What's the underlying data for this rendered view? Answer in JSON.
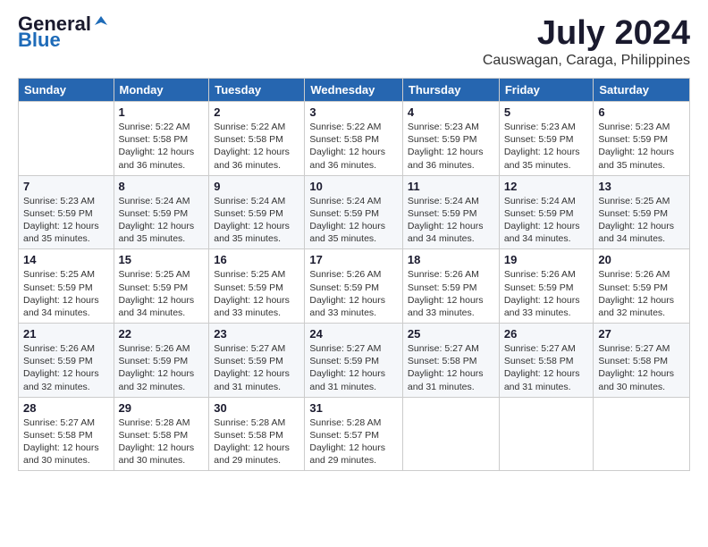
{
  "logo": {
    "general": "General",
    "blue": "Blue"
  },
  "title": {
    "month_year": "July 2024",
    "location": "Causwagan, Caraga, Philippines"
  },
  "headers": [
    "Sunday",
    "Monday",
    "Tuesday",
    "Wednesday",
    "Thursday",
    "Friday",
    "Saturday"
  ],
  "weeks": [
    [
      {
        "day": "",
        "info": ""
      },
      {
        "day": "1",
        "info": "Sunrise: 5:22 AM\nSunset: 5:58 PM\nDaylight: 12 hours\nand 36 minutes."
      },
      {
        "day": "2",
        "info": "Sunrise: 5:22 AM\nSunset: 5:58 PM\nDaylight: 12 hours\nand 36 minutes."
      },
      {
        "day": "3",
        "info": "Sunrise: 5:22 AM\nSunset: 5:58 PM\nDaylight: 12 hours\nand 36 minutes."
      },
      {
        "day": "4",
        "info": "Sunrise: 5:23 AM\nSunset: 5:59 PM\nDaylight: 12 hours\nand 36 minutes."
      },
      {
        "day": "5",
        "info": "Sunrise: 5:23 AM\nSunset: 5:59 PM\nDaylight: 12 hours\nand 35 minutes."
      },
      {
        "day": "6",
        "info": "Sunrise: 5:23 AM\nSunset: 5:59 PM\nDaylight: 12 hours\nand 35 minutes."
      }
    ],
    [
      {
        "day": "7",
        "info": "Sunrise: 5:23 AM\nSunset: 5:59 PM\nDaylight: 12 hours\nand 35 minutes."
      },
      {
        "day": "8",
        "info": "Sunrise: 5:24 AM\nSunset: 5:59 PM\nDaylight: 12 hours\nand 35 minutes."
      },
      {
        "day": "9",
        "info": "Sunrise: 5:24 AM\nSunset: 5:59 PM\nDaylight: 12 hours\nand 35 minutes."
      },
      {
        "day": "10",
        "info": "Sunrise: 5:24 AM\nSunset: 5:59 PM\nDaylight: 12 hours\nand 35 minutes."
      },
      {
        "day": "11",
        "info": "Sunrise: 5:24 AM\nSunset: 5:59 PM\nDaylight: 12 hours\nand 34 minutes."
      },
      {
        "day": "12",
        "info": "Sunrise: 5:24 AM\nSunset: 5:59 PM\nDaylight: 12 hours\nand 34 minutes."
      },
      {
        "day": "13",
        "info": "Sunrise: 5:25 AM\nSunset: 5:59 PM\nDaylight: 12 hours\nand 34 minutes."
      }
    ],
    [
      {
        "day": "14",
        "info": "Sunrise: 5:25 AM\nSunset: 5:59 PM\nDaylight: 12 hours\nand 34 minutes."
      },
      {
        "day": "15",
        "info": "Sunrise: 5:25 AM\nSunset: 5:59 PM\nDaylight: 12 hours\nand 34 minutes."
      },
      {
        "day": "16",
        "info": "Sunrise: 5:25 AM\nSunset: 5:59 PM\nDaylight: 12 hours\nand 33 minutes."
      },
      {
        "day": "17",
        "info": "Sunrise: 5:26 AM\nSunset: 5:59 PM\nDaylight: 12 hours\nand 33 minutes."
      },
      {
        "day": "18",
        "info": "Sunrise: 5:26 AM\nSunset: 5:59 PM\nDaylight: 12 hours\nand 33 minutes."
      },
      {
        "day": "19",
        "info": "Sunrise: 5:26 AM\nSunset: 5:59 PM\nDaylight: 12 hours\nand 33 minutes."
      },
      {
        "day": "20",
        "info": "Sunrise: 5:26 AM\nSunset: 5:59 PM\nDaylight: 12 hours\nand 32 minutes."
      }
    ],
    [
      {
        "day": "21",
        "info": "Sunrise: 5:26 AM\nSunset: 5:59 PM\nDaylight: 12 hours\nand 32 minutes."
      },
      {
        "day": "22",
        "info": "Sunrise: 5:26 AM\nSunset: 5:59 PM\nDaylight: 12 hours\nand 32 minutes."
      },
      {
        "day": "23",
        "info": "Sunrise: 5:27 AM\nSunset: 5:59 PM\nDaylight: 12 hours\nand 31 minutes."
      },
      {
        "day": "24",
        "info": "Sunrise: 5:27 AM\nSunset: 5:59 PM\nDaylight: 12 hours\nand 31 minutes."
      },
      {
        "day": "25",
        "info": "Sunrise: 5:27 AM\nSunset: 5:58 PM\nDaylight: 12 hours\nand 31 minutes."
      },
      {
        "day": "26",
        "info": "Sunrise: 5:27 AM\nSunset: 5:58 PM\nDaylight: 12 hours\nand 31 minutes."
      },
      {
        "day": "27",
        "info": "Sunrise: 5:27 AM\nSunset: 5:58 PM\nDaylight: 12 hours\nand 30 minutes."
      }
    ],
    [
      {
        "day": "28",
        "info": "Sunrise: 5:27 AM\nSunset: 5:58 PM\nDaylight: 12 hours\nand 30 minutes."
      },
      {
        "day": "29",
        "info": "Sunrise: 5:28 AM\nSunset: 5:58 PM\nDaylight: 12 hours\nand 30 minutes."
      },
      {
        "day": "30",
        "info": "Sunrise: 5:28 AM\nSunset: 5:58 PM\nDaylight: 12 hours\nand 29 minutes."
      },
      {
        "day": "31",
        "info": "Sunrise: 5:28 AM\nSunset: 5:57 PM\nDaylight: 12 hours\nand 29 minutes."
      },
      {
        "day": "",
        "info": ""
      },
      {
        "day": "",
        "info": ""
      },
      {
        "day": "",
        "info": ""
      }
    ]
  ]
}
